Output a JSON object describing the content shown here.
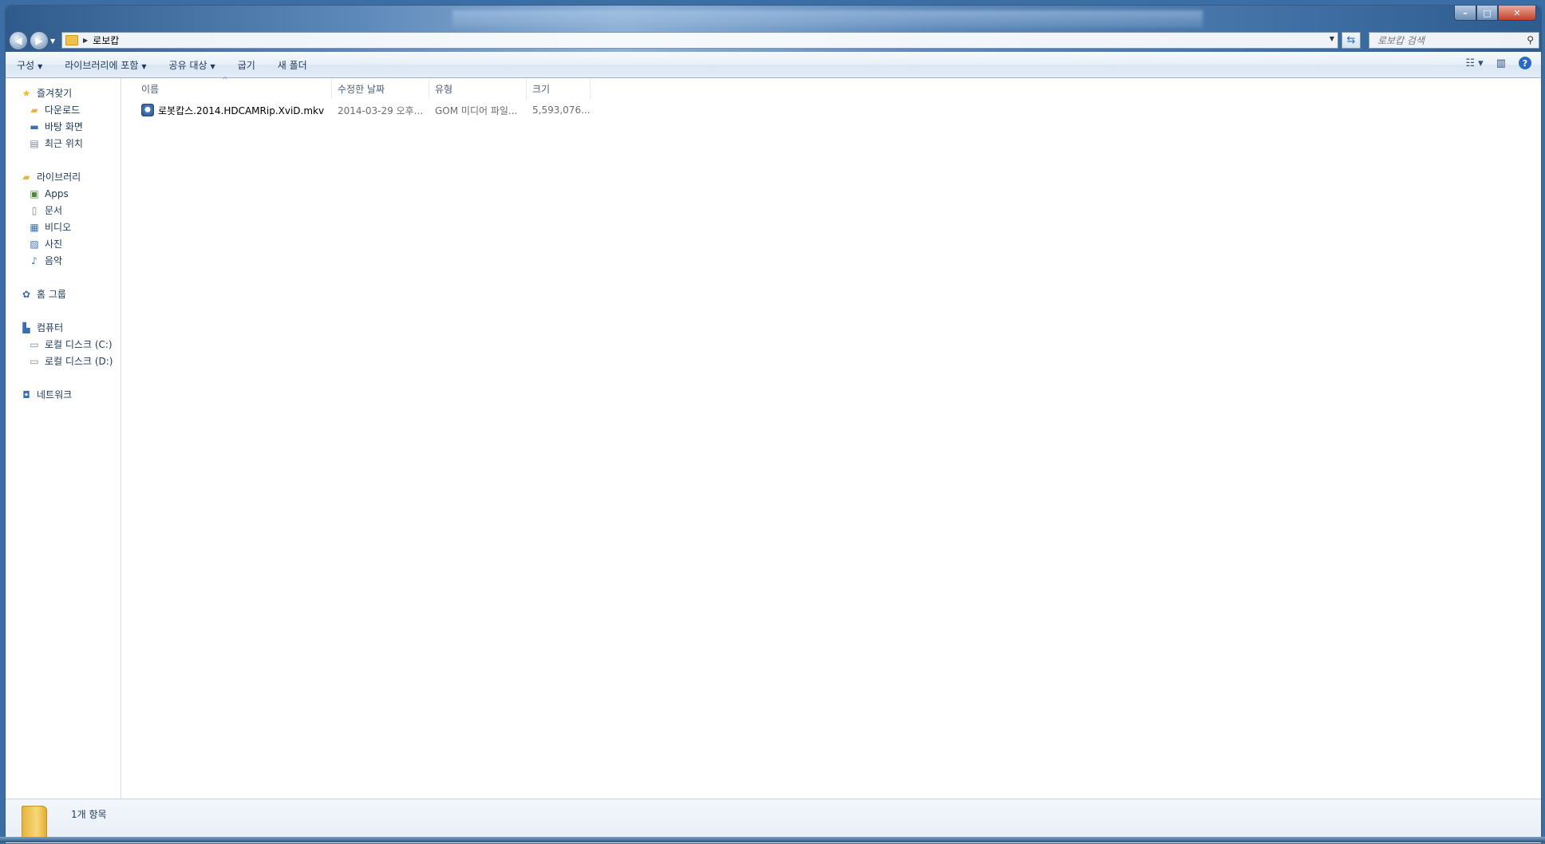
{
  "address": {
    "crumb": "로보캅"
  },
  "search": {
    "placeholder": "로보캅 검색"
  },
  "toolbar": {
    "organize": "구성",
    "include_in_library": "라이브러리에 포함",
    "share_with": "공유 대상",
    "burn": "굽기",
    "new_folder": "새 폴더"
  },
  "sidebar": {
    "favorites": {
      "label": "즐겨찾기",
      "items": [
        "다운로드",
        "바탕 화면",
        "최근 위치"
      ]
    },
    "libraries": {
      "label": "라이브러리",
      "items": [
        "Apps",
        "문서",
        "비디오",
        "사진",
        "음악"
      ]
    },
    "homegroup": "홈 그룹",
    "computer": {
      "label": "컴퓨터",
      "items": [
        "로컬 디스크 (C:)",
        "로컬 디스크 (D:)"
      ]
    },
    "network": "네트워크"
  },
  "columns": {
    "name": "이름",
    "date": "수정한 날짜",
    "type": "유형",
    "size": "크기"
  },
  "files": [
    {
      "name": "로봇캅스.2014.HDCAMRip.XviD.mkv",
      "date": "2014-03-29 오후...",
      "type": "GOM 미디어 파일...",
      "size": "5,593,076..."
    }
  ],
  "status": {
    "item_count": "1개 항목"
  }
}
